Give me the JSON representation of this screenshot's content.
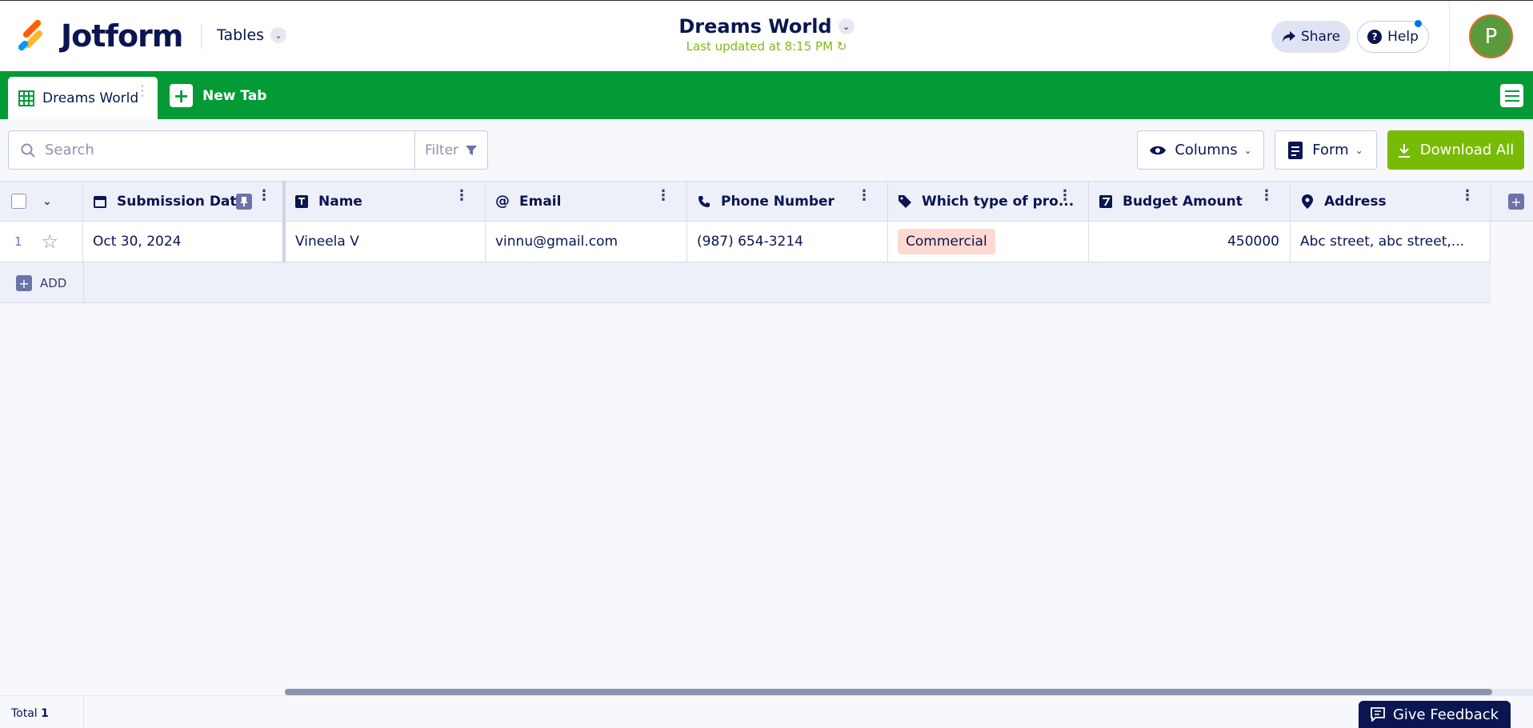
{
  "header": {
    "logo_text": "Jotform",
    "tables_label": "Tables",
    "title": "Dreams World",
    "updated": "Last updated at 8:15 PM",
    "share_label": "Share",
    "help_label": "Help",
    "help_glyph": "?",
    "avatar_initial": "P",
    "colors": {
      "brand_green": "#049b36",
      "accent_lime": "#78bb07",
      "navy": "#0a1551"
    }
  },
  "tabs": {
    "active_label": "Dreams World",
    "new_tab_label": "New Tab"
  },
  "toolbar": {
    "search_placeholder": "Search",
    "filter_label": "Filter",
    "columns_label": "Columns",
    "form_label": "Form",
    "download_label": "Download All"
  },
  "table": {
    "columns": [
      {
        "label": "Submission Date",
        "icon": "calendar-icon"
      },
      {
        "label": "Name",
        "icon": "text-icon"
      },
      {
        "label": "Email",
        "icon": "at-icon"
      },
      {
        "label": "Phone Number",
        "icon": "phone-icon"
      },
      {
        "label": "Which type of pro...",
        "icon": "tag-icon"
      },
      {
        "label": "Budget Amount",
        "icon": "number-icon"
      },
      {
        "label": "Address",
        "icon": "location-pin-icon"
      }
    ],
    "rows": [
      {
        "index": "1",
        "cells": [
          "Oct 30, 2024",
          "Vineela V",
          "vinnu@gmail.com",
          "(987) 654-3214",
          "Commercial",
          "450000",
          "Abc street, abc street,..."
        ]
      }
    ],
    "add_label": "ADD"
  },
  "footer": {
    "total_label": "Total",
    "total_value": "1",
    "feedback_label": "Give Feedback"
  }
}
